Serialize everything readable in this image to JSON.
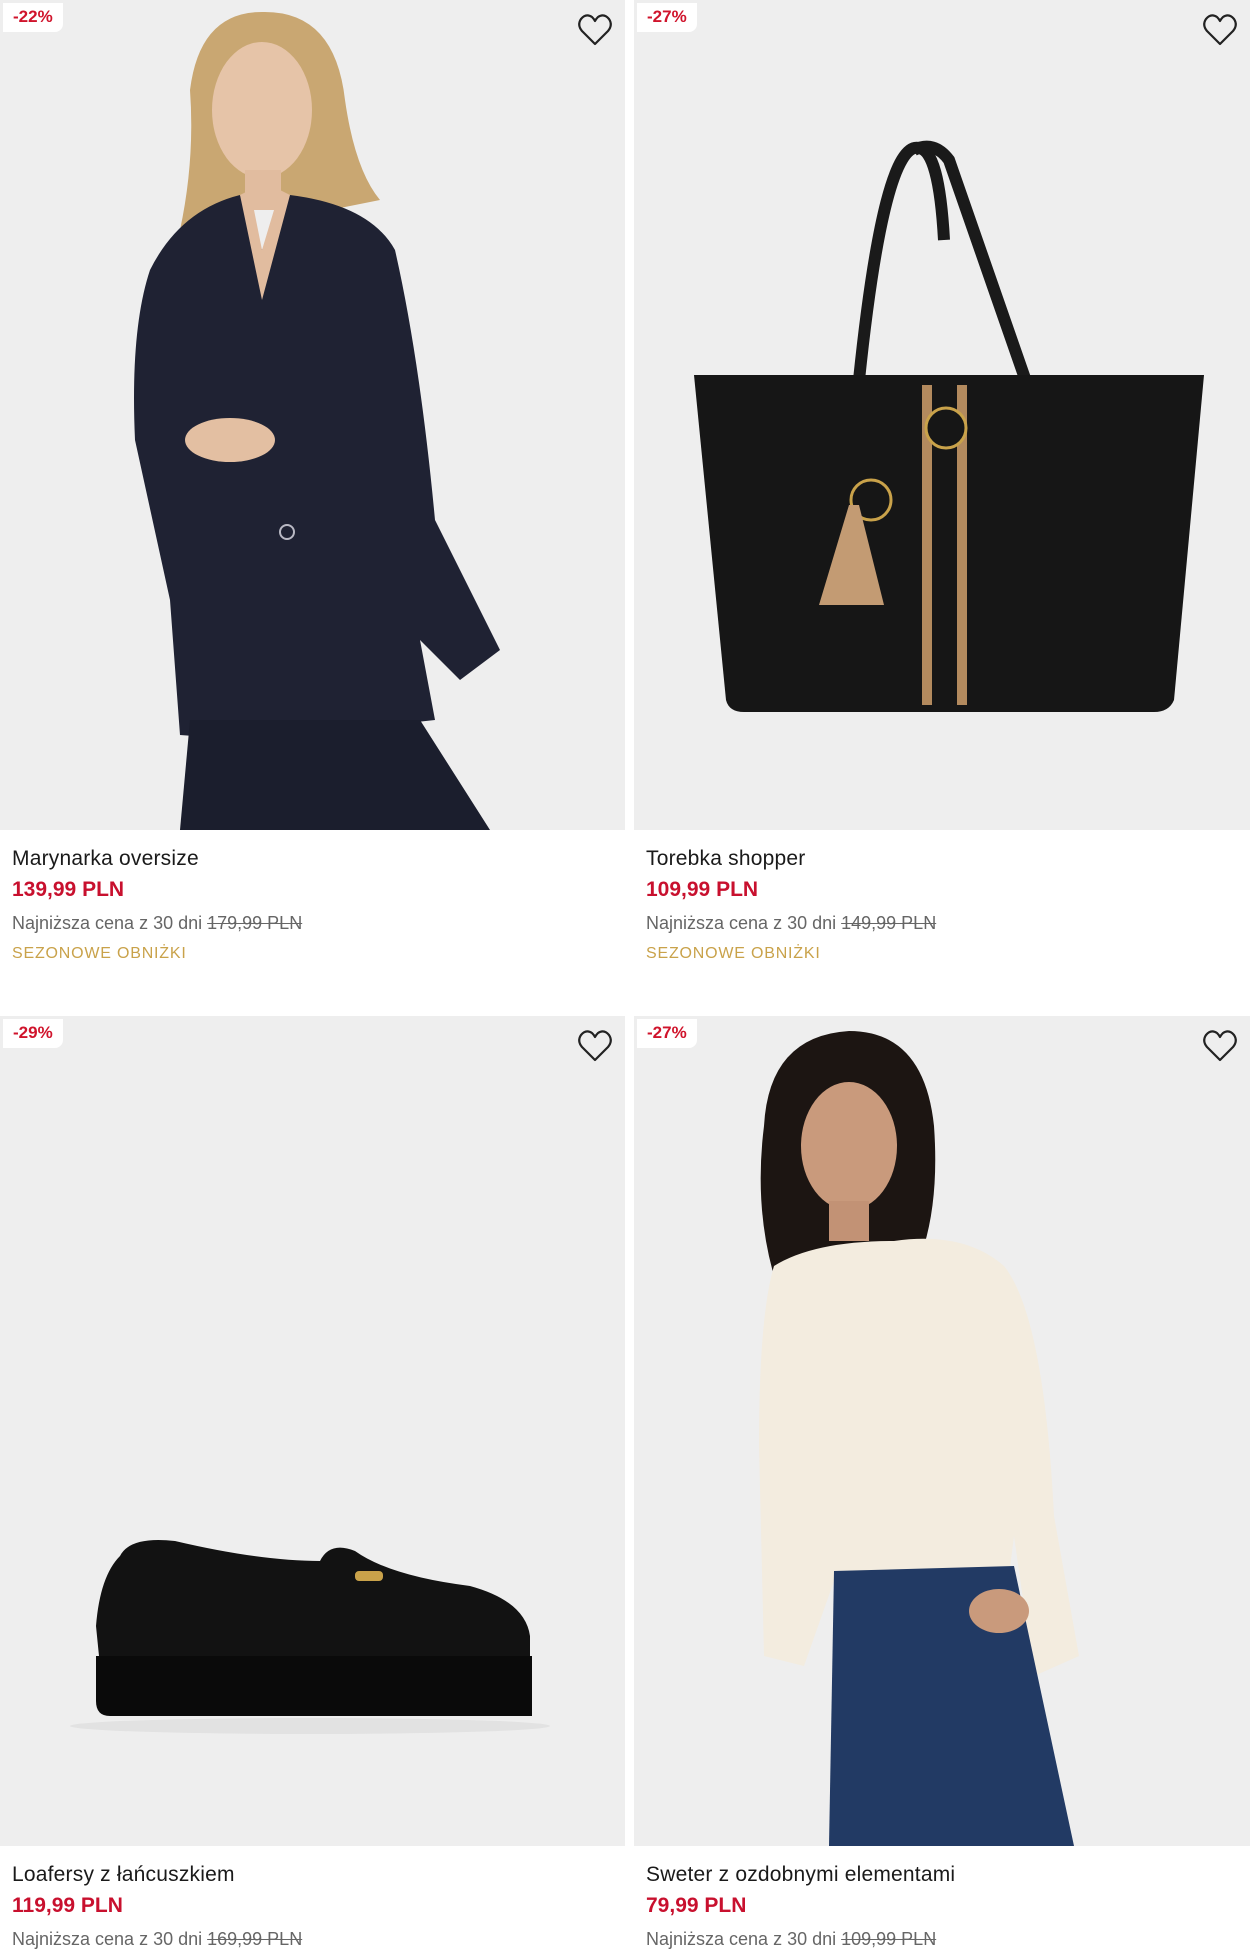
{
  "products": [
    {
      "discount": "-22%",
      "name": "Marynarka oversize",
      "price": "139,99 PLN",
      "lowest_label": "Najniższa cena z 30 dni",
      "old_price": "179,99 PLN",
      "promo": "SEZONOWE OBNIŻKI",
      "image": "woman-pinstripe-blazer-photo"
    },
    {
      "discount": "-27%",
      "name": "Torebka shopper",
      "price": "109,99 PLN",
      "lowest_label": "Najniższa cena z 30 dni",
      "old_price": "149,99 PLN",
      "promo": "SEZONOWE OBNIŻKI",
      "image": "black-shopper-bag-photo"
    },
    {
      "discount": "-29%",
      "name": "Loafersy z łańcuszkiem",
      "price": "119,99 PLN",
      "lowest_label": "Najniższa cena z 30 dni",
      "old_price": "169,99 PLN",
      "image": "black-loafer-photo"
    },
    {
      "discount": "-27%",
      "name": "Sweter z ozdobnymi elementami",
      "price": "79,99 PLN",
      "lowest_label": "Najniższa cena z 30 dni",
      "old_price": "109,99 PLN",
      "image": "woman-cream-sweater-photo"
    }
  ],
  "colors": {
    "price": "#c8102e",
    "badge": "#d0142c",
    "promo": "#c9a24a",
    "image_bg": "#efefef"
  },
  "icons": [
    "heart-outline-icon"
  ]
}
